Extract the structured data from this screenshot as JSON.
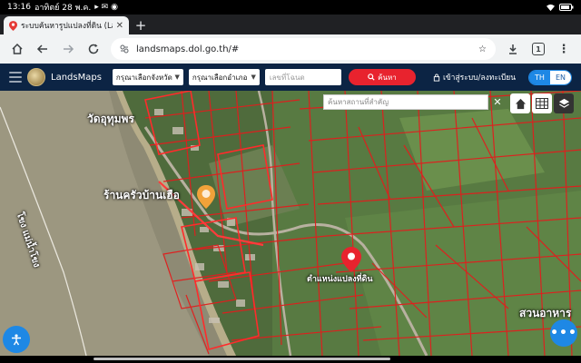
{
  "status_bar": {
    "time": "13:16",
    "date": "อาทิตย์ 28 พ.ค."
  },
  "browser": {
    "tab_title": "ระบบค้นหารูปแปลงที่ดิน (Lands",
    "url": "landsmaps.dol.go.th/#",
    "tab_count": "1"
  },
  "app": {
    "brand": "LandsMaps",
    "province_select": "กรุณาเลือกจังหวัด",
    "district_select": "กรุณาเลือกอำเภอ",
    "parcel_placeholder": "เลขที่โฉนด",
    "search_label": "ค้นหา",
    "login_label": "เข้าสู่ระบบ/ลงทะเบียน",
    "lang_th": "TH",
    "lang_en": "EN"
  },
  "map": {
    "place_search_placeholder": "ค้นหาสถานที่สำคัญ",
    "labels": {
      "temple": "วัดอุทุมพร",
      "restaurant": "ร้านครัวบ้านเฮือ",
      "parcel_location": "ตำแหน่งแปลงที่ดิน",
      "river": "โขง แม่น้ำโขง",
      "food_garden": "สวนอาหาร"
    }
  }
}
